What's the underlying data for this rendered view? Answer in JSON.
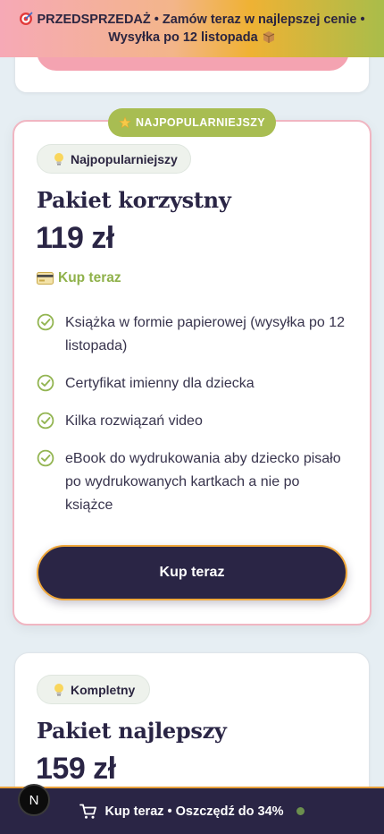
{
  "promo": {
    "line1": "PRZEDSPRZEDAŻ • Zamów teraz w najlepszej cenie •",
    "line2": "Wysyłka po 12 listopada",
    "target_icon": "target-icon",
    "package_icon": "package-icon"
  },
  "featured_card": {
    "ribbon": "NAJPOPULARNIEJSZY",
    "chip": "Najpopularniejszy",
    "title": "Pakiet korzystny",
    "price": "119 zł",
    "buy_link": "Kup teraz",
    "features": [
      "Książka w formie papierowej (wysyłka po 12 listopada)",
      "Certyfikat imienny dla dziecka",
      "Kilka rozwiązań video",
      "eBook do wydrukowania aby dziecko pisało po wydrukowanych kartkach a nie po książce"
    ],
    "cta": "Kup teraz"
  },
  "third_card": {
    "chip": "Kompletny",
    "title": "Pakiet najlepszy",
    "price": "159 zł"
  },
  "bottom_bar": {
    "label": "Kup teraz • Oszczędź do 34%"
  },
  "dev_badge": "N",
  "colors": {
    "navy": "#2a2545",
    "accent_green": "#a8bd52",
    "accent_orange": "#f0a83a",
    "card_border_pink": "#f0b6c2"
  }
}
